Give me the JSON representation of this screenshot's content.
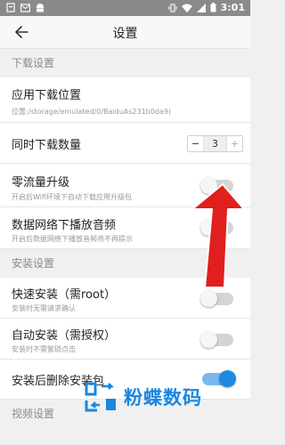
{
  "statusbar": {
    "time": "3:01"
  },
  "header": {
    "title": "设置"
  },
  "sections": {
    "download": "下载设置",
    "install": "安装设置",
    "video": "视频设置"
  },
  "download_location": {
    "label": "应用下载位置",
    "path": "位置:/storage/emulated/0/BaiduAs231b0da9)"
  },
  "concurrent_downloads": {
    "label": "同时下载数量",
    "minus": "−",
    "value": "3",
    "plus": "+"
  },
  "zero_traffic": {
    "label": "零流量升级",
    "desc": "开启后Wifi环境下自动下载应用升级包",
    "state": "off"
  },
  "mobile_audio": {
    "label": "数据网络下播放音频",
    "desc": "开启后数据网络下播放音频将不再提示",
    "state": "off"
  },
  "quick_install": {
    "label": "快速安装（需root）",
    "desc": "安装时无需请求确认",
    "state": "off"
  },
  "auto_install": {
    "label": "自动安装（需授权）",
    "desc": "安装时不需繁琐点击",
    "state": "off"
  },
  "delete_after_install": {
    "label": "安装后删除安装包",
    "state": "on"
  },
  "watermark": {
    "brand": "粉蝶数码"
  },
  "colors": {
    "accent": "#1e88e5",
    "arrow": "#e0201e",
    "statusbar": "#8a8a8a"
  }
}
